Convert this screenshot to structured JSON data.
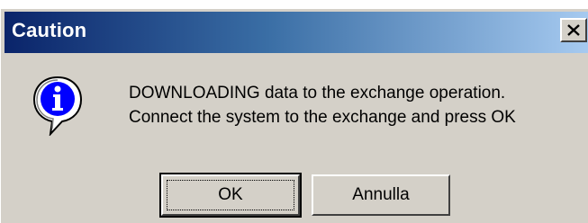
{
  "window": {
    "title": "Caution"
  },
  "message": {
    "line1": "DOWNLOADING data to the exchange operation.",
    "line2": "Connect the system to the exchange and press OK"
  },
  "buttons": {
    "ok_label": "OK",
    "cancel_label": "Annulla"
  },
  "icons": {
    "close": "close-icon",
    "info": "info-icon"
  }
}
